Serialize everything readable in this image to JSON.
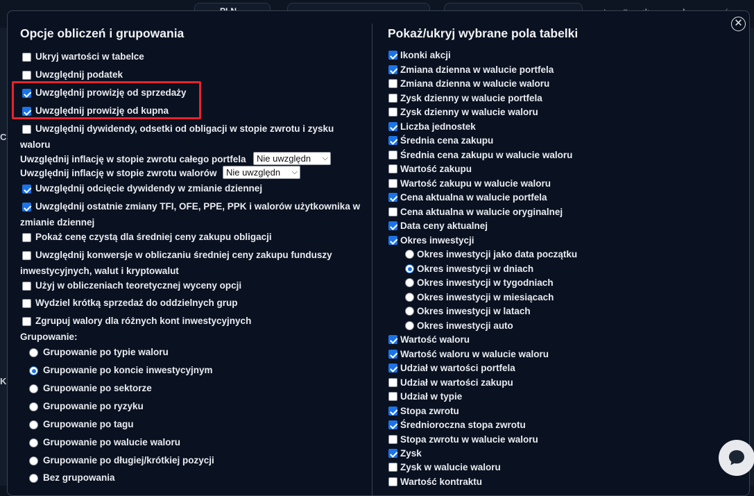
{
  "background": {
    "top_tab_label": "PLN",
    "left_fragment_1": "C",
    "left_fragment_2": "K"
  },
  "modal": {
    "close_icon": "close-circle-icon",
    "left": {
      "title": "Opcje obliczeń i grupowania",
      "options": [
        {
          "label": "Ukryj wartości w tabelce",
          "checked": false
        },
        {
          "label": "Uwzględnij podatek",
          "checked": false
        },
        {
          "label": "Uwzględnij prowizję od sprzedaży",
          "checked": true
        },
        {
          "label": "Uwzględnij prowizję od kupna",
          "checked": true
        },
        {
          "label": "Uwzględnij dywidendy, odsetki od obligacji w stopie zwrotu i zysku",
          "label_line2": "waloru",
          "checked": false
        },
        {
          "label": "Uwzględnij odcięcie dywidendy w zmianie dziennej",
          "checked": true
        },
        {
          "label": "Uwzględnij ostatnie zmiany TFI, OFE, PPE, PPK i walorów użytkownika w",
          "label_line2": "zmianie dziennej",
          "checked": true
        },
        {
          "label": "Pokaż cenę czystą dla średniej ceny zakupu obligacji",
          "checked": false
        },
        {
          "label": "Uwzględnij konwersje w obliczaniu średniej ceny zakupu funduszy",
          "label_line2": "inwestycyjnych, walut i kryptowalut",
          "checked": false
        },
        {
          "label": "Użyj w obliczeniach teoretycznej wyceny opcji",
          "checked": false
        },
        {
          "label": "Wydziel krótką sprzedaż do oddzielnych grup",
          "checked": false
        },
        {
          "label": "Zgrupuj walory dla różnych kont inwestycyjnych",
          "checked": false
        }
      ],
      "inflation_portfolio": {
        "label": "Uwzględnij inflację w stopie zwrotu całego portfela",
        "value": "Nie uwzględn"
      },
      "inflation_assets": {
        "label": "Uwzględnij inflację w stopie zwrotu walorów",
        "value": "Nie uwzględn"
      },
      "grouping_label": "Grupowanie:",
      "grouping": [
        {
          "label": "Grupowanie po typie waloru",
          "selected": false
        },
        {
          "label": "Grupowanie po koncie inwestycyjnym",
          "selected": true
        },
        {
          "label": "Grupowanie po sektorze",
          "selected": false
        },
        {
          "label": "Grupowanie po ryzyku",
          "selected": false
        },
        {
          "label": "Grupowanie po tagu",
          "selected": false
        },
        {
          "label": "Grupowanie po walucie waloru",
          "selected": false
        },
        {
          "label": "Grupowanie po długiej/krótkiej pozycji",
          "selected": false
        },
        {
          "label": "Bez grupowania",
          "selected": false
        }
      ]
    },
    "right": {
      "title": "Pokaż/ukryj wybrane pola tabelki",
      "fields": [
        {
          "label": "Ikonki akcji",
          "checked": true
        },
        {
          "label": "Zmiana dzienna w walucie portfela",
          "checked": true
        },
        {
          "label": "Zmiana dzienna w walucie waloru",
          "checked": false
        },
        {
          "label": "Zysk dzienny w walucie portfela",
          "checked": false
        },
        {
          "label": "Zysk dzienny w walucie waloru",
          "checked": false
        },
        {
          "label": "Liczba jednostek",
          "checked": true
        },
        {
          "label": "Średnia cena zakupu",
          "checked": true
        },
        {
          "label": "Średnia cena zakupu w walucie waloru",
          "checked": false
        },
        {
          "label": "Wartość zakupu",
          "checked": false
        },
        {
          "label": "Wartość zakupu w walucie waloru",
          "checked": false
        },
        {
          "label": "Cena aktualna w walucie portfela",
          "checked": true
        },
        {
          "label": "Cena aktualna w walucie oryginalnej",
          "checked": false
        },
        {
          "label": "Data ceny aktualnej",
          "checked": true
        },
        {
          "label": "Okres inwestycji",
          "checked": true
        }
      ],
      "period_options": [
        {
          "label": "Okres inwestycji jako data początku",
          "selected": false
        },
        {
          "label": "Okres inwestycji w dniach",
          "selected": true
        },
        {
          "label": "Okres inwestycji w tygodniach",
          "selected": false
        },
        {
          "label": "Okres inwestycji w miesiącach",
          "selected": false
        },
        {
          "label": "Okres inwestycji w latach",
          "selected": false
        },
        {
          "label": "Okres inwestycji auto",
          "selected": false
        }
      ],
      "fields2": [
        {
          "label": "Wartość waloru",
          "checked": true
        },
        {
          "label": "Wartość waloru w walucie waloru",
          "checked": true
        },
        {
          "label": "Udział w wartości portfela",
          "checked": true
        },
        {
          "label": "Udział w wartości zakupu",
          "checked": false
        },
        {
          "label": "Udział w typie",
          "checked": false
        },
        {
          "label": "Stopa zwrotu",
          "checked": true
        },
        {
          "label": "Średnioroczna stopa zwrotu",
          "checked": true
        },
        {
          "label": "Stopa zwrotu w walucie waloru",
          "checked": false
        },
        {
          "label": "Zysk",
          "checked": true
        },
        {
          "label": "Zysk w walucie waloru",
          "checked": false
        },
        {
          "label": "Wartość kontraktu",
          "checked": false
        }
      ]
    }
  },
  "chat_icon": "chat-bubble-icon"
}
